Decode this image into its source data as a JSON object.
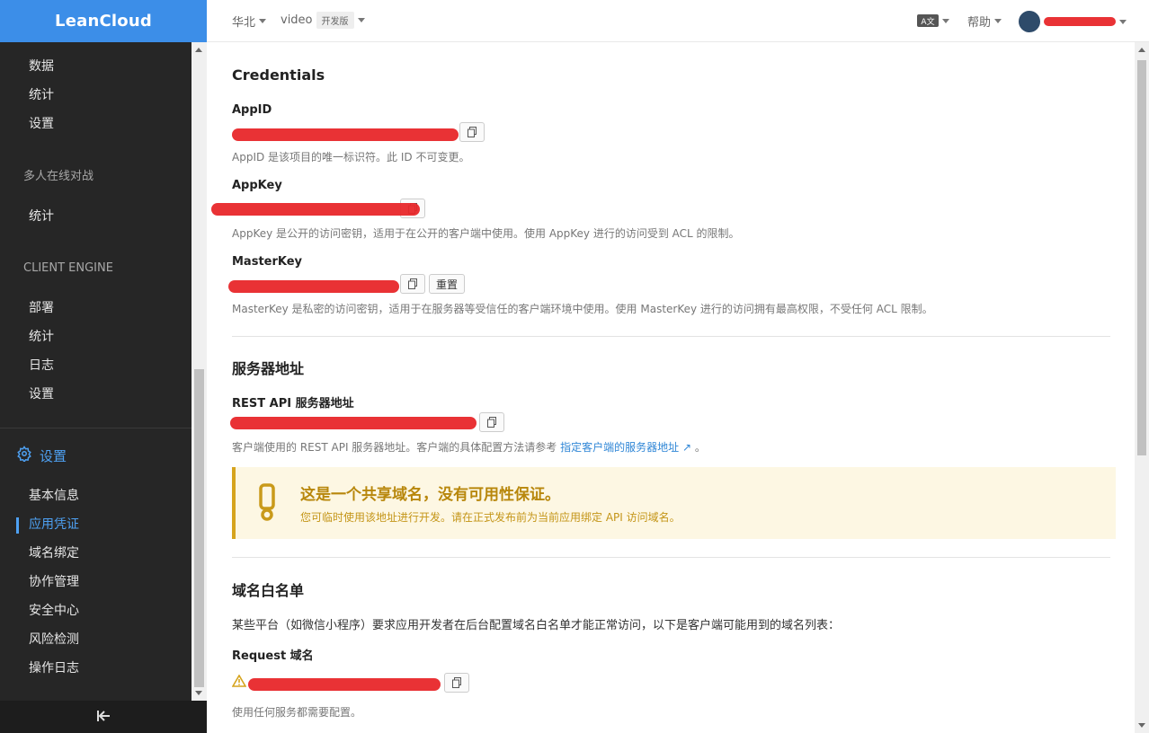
{
  "brand": "LeanCloud",
  "sidebar": {
    "group1": [
      "数据",
      "统计",
      "设置"
    ],
    "header_multiplayer": "多人在线对战",
    "group2": [
      "统计"
    ],
    "header_client_engine": "CLIENT ENGINE",
    "group3": [
      "部署",
      "统计",
      "日志",
      "设置"
    ],
    "settings_label": "设置",
    "settings_items": [
      "基本信息",
      "应用凭证",
      "域名绑定",
      "协作管理",
      "安全中心",
      "风险检测",
      "操作日志"
    ],
    "active_item": "应用凭证"
  },
  "topbar": {
    "region": "华北",
    "app_name": "video",
    "app_badge": "开发版",
    "lang_icon": "A文",
    "help": "帮助"
  },
  "credentials": {
    "title": "Credentials",
    "appid_label": "AppID",
    "appid_help": "AppID 是该项目的唯一标识符。此 ID 不可变更。",
    "appkey_label": "AppKey",
    "appkey_help": "AppKey 是公开的访问密钥，适用于在公开的客户端中使用。使用 AppKey 进行的访问受到 ACL 的限制。",
    "masterkey_label": "MasterKey",
    "reset_label": "重置",
    "masterkey_help": "MasterKey 是私密的访问密钥，适用于在服务器等受信任的客户端环境中使用。使用 MasterKey 进行的访问拥有最高权限，不受任何 ACL 限制。"
  },
  "server": {
    "title": "服务器地址",
    "rest_label": "REST API 服务器地址",
    "rest_help": "客户端使用的 REST API 服务器地址。客户端的具体配置方法请参考",
    "rest_link": "指定客户端的服务器地址",
    "rest_help_end": "。",
    "warn_title": "这是一个共享域名，没有可用性保证。",
    "warn_sub": "您可临时使用该地址进行开发。请在正式发布前为当前应用绑定 API 访问域名。"
  },
  "whitelist": {
    "title": "域名白名单",
    "desc": "某些平台（如微信小程序）要求应用开发者在后台配置域名白名单才能正常访问，以下是客户端可能用到的域名列表：",
    "request_label": "Request 域名",
    "request_help": "使用任何服务都需要配置。"
  },
  "colors": {
    "accent": "#4ea1f3",
    "brand": "#3c8ee8",
    "warning": "#d6a41e",
    "redaction": "#e8272a"
  }
}
